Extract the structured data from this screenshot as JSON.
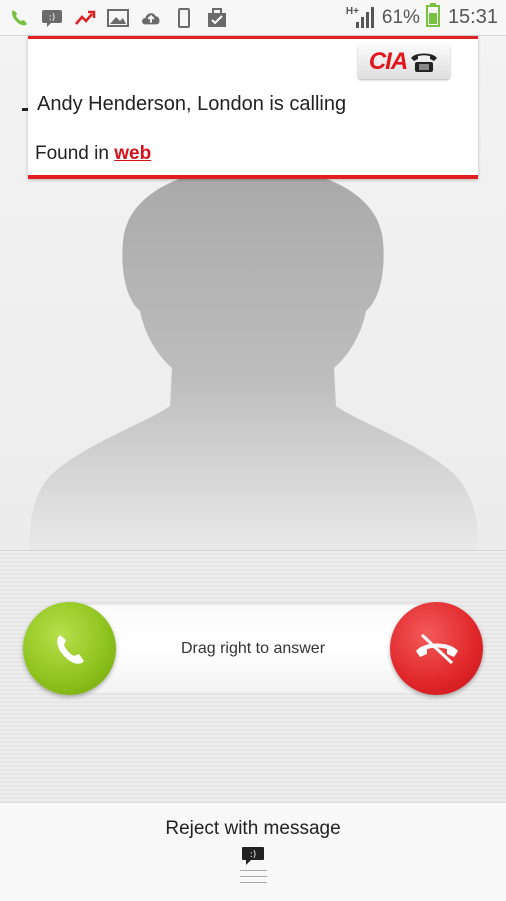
{
  "status_bar": {
    "battery_percent": "61%",
    "time": "15:31",
    "network_label": "H+",
    "icons": [
      "phone-icon",
      "chat-icon",
      "missed-call-icon",
      "image-icon",
      "cloud-upload-icon",
      "phone-device-icon",
      "briefcase-icon",
      "signal-icon",
      "battery-icon"
    ],
    "colors": {
      "battery": "#7ac143",
      "missed": "#e02020",
      "phone": "#7ac143"
    }
  },
  "caller_card": {
    "logo_text": "CIA",
    "caller_text": "Andy Henderson, London is calling",
    "found_prefix": "Found in ",
    "found_link": "web",
    "colors": {
      "accent": "#e02020"
    }
  },
  "call_controls": {
    "drag_label": "Drag right to answer",
    "answer_icon": "phone-answer-icon",
    "reject_icon": "phone-hangup-icon",
    "colors": {
      "answer": "#8cc11c",
      "reject": "#e0262a"
    }
  },
  "bottom": {
    "reject_message_label": "Reject with message",
    "message_icon": "message-bubble-icon",
    "message_icon_text": ":)"
  }
}
